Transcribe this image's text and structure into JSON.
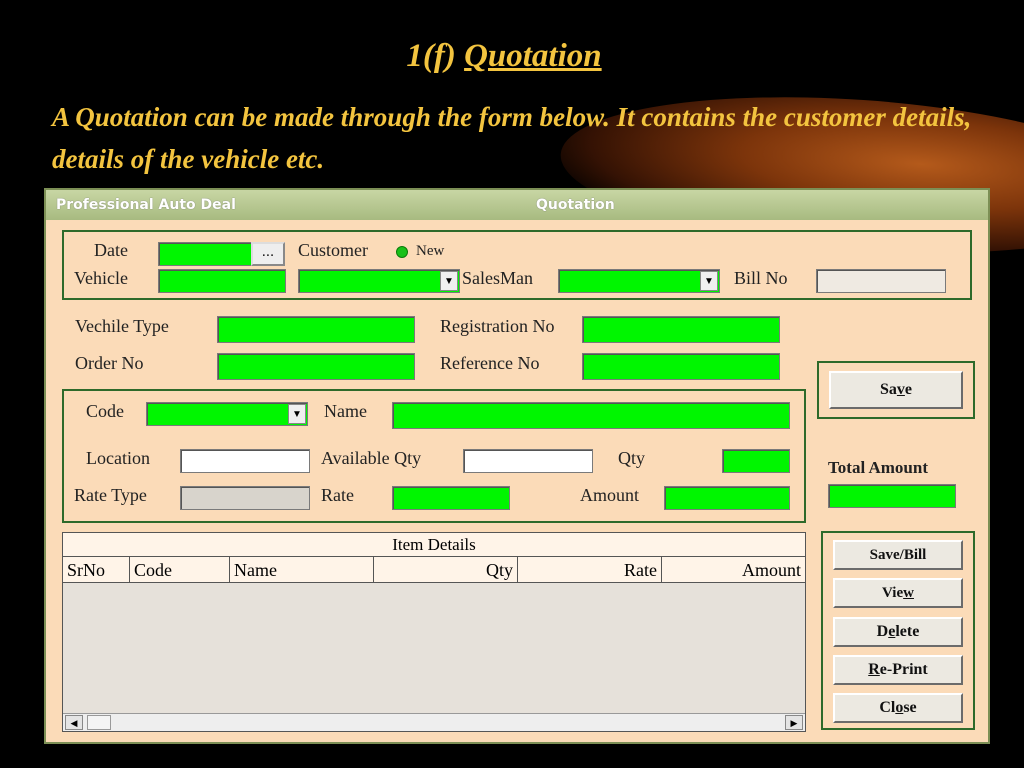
{
  "slide": {
    "title_prefix": "1(f)",
    "title_main": "Quotation",
    "description": "A Quotation can be made through the form below. It contains the customer details, details of the vehicle etc."
  },
  "window": {
    "app_title": "Professional Auto Deal",
    "form_title": "Quotation"
  },
  "header_group": {
    "date_label": "Date",
    "date_button": "...",
    "customer_label": "Customer",
    "customer_option": "New",
    "vehicle_label": "Vehicle",
    "salesman_label": "SalesMan",
    "billno_label": "Bill No"
  },
  "vehicle_info": {
    "vehicle_type_label": "Vechile Type",
    "registration_label": "Registration No",
    "order_label": "Order No",
    "reference_label": "Reference No"
  },
  "item_group": {
    "code_label": "Code",
    "name_label": "Name",
    "location_label": "Location",
    "available_qty_label": "Available Qty",
    "qty_label": "Qty",
    "rate_type_label": "Rate Type",
    "rate_label": "Rate",
    "amount_label": "Amount"
  },
  "save_button": {
    "pre": "Sa",
    "u": "v",
    "post": "e"
  },
  "total_amount_label": "Total Amount",
  "grid": {
    "title": "Item Details",
    "columns": [
      "SrNo",
      "Code",
      "Name",
      "Qty",
      "Rate",
      "Amount"
    ]
  },
  "buttons": {
    "save_bill": "Save/Bill",
    "view": {
      "pre": "Vie",
      "u": "w",
      "post": ""
    },
    "delete": {
      "pre": "D",
      "u": "e",
      "post": "lete"
    },
    "reprint": {
      "pre": "",
      "u": "R",
      "post": "e-Print"
    },
    "close": {
      "pre": "Cl",
      "u": "o",
      "post": "se"
    }
  },
  "icons": {
    "dropdown": "chevron-down-icon",
    "scroll_left": "arrow-left-icon",
    "scroll_right": "arrow-right-icon"
  },
  "colors": {
    "slide_text": "#f3c43f",
    "form_bg": "#fbdbb8",
    "field_green": "#00f600",
    "group_border": "#2e6a2a"
  }
}
